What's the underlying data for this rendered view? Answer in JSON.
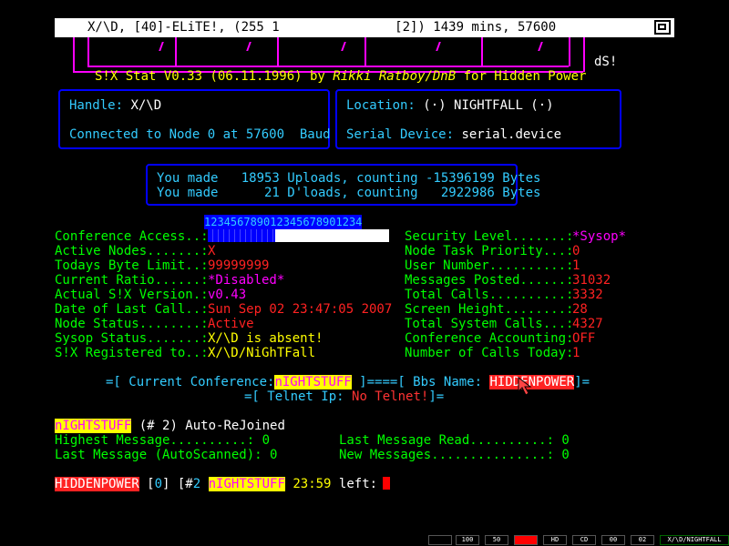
{
  "title_bar": {
    "text": "X/\\D, [40]-ELiTE!, (255 1               [2]) 1439 mins, 57600"
  },
  "header": {
    "stat_line_a": "S!X Stat V0.33 (06.11.1996) by ",
    "author": "Rikki Ratboy/DnB",
    "stat_line_b": " for Hidden Power",
    "ds_label": "dS!"
  },
  "info": {
    "handle_label": "Handle:",
    "handle_value": "X/\\D",
    "location_label": "Location:",
    "location_value": "(·) NIGHTFALL (·)",
    "connected": "Connected to Node 0 at 57600  Baud",
    "serial_label": "Serial Device:",
    "serial_value": "serial.device"
  },
  "transfer": {
    "line1": "You made   18953 Uploads, counting -15396199 Bytes",
    "line2": "You made      21 D'loads, counting   2922986 Bytes"
  },
  "access_ticks": "123456789012345678901234",
  "access_fill_fraction": 0.37,
  "left_stats": [
    {
      "label": "Conference Access..:",
      "value": "",
      "color": "#f22"
    },
    {
      "label": "Active Nodes.......:",
      "value": "X",
      "color": "#f22"
    },
    {
      "label": "Todays Byte Limit..:",
      "value": "99999999",
      "color": "#f22"
    },
    {
      "label": "Current Ratio......:",
      "value": "*Disabled*",
      "color": "#f0f"
    },
    {
      "label": "Actual S!X Version.:",
      "value": "v0.43",
      "color": "#f0f"
    },
    {
      "label": "Date of Last Call..:",
      "value": "Sun Sep 02 23:47:05 2007",
      "color": "#f22"
    },
    {
      "label": "Node Status........:",
      "value": "Active",
      "color": "#f22"
    },
    {
      "label": "Sysop Status.......:",
      "value": "X/\\D is absent!",
      "color": "#ff0"
    },
    {
      "label": "S!X Registered to..:",
      "value": "X/\\D/NiGhTFall",
      "color": "#ff0"
    }
  ],
  "right_stats": [
    {
      "label": "Security Level.......:",
      "value": "*Sysop*",
      "color": "#f0f"
    },
    {
      "label": "Node Task Priority...:",
      "value": "0",
      "color": "#f22"
    },
    {
      "label": "User Number..........:",
      "value": "1",
      "color": "#f22"
    },
    {
      "label": "Messages Posted......:",
      "value": "31032",
      "color": "#f22"
    },
    {
      "label": "Total Calls..........:",
      "value": "3332",
      "color": "#f22"
    },
    {
      "label": "Screen Height........:",
      "value": "28",
      "color": "#f22"
    },
    {
      "label": "Total System Calls...:",
      "value": "4327",
      "color": "#f22"
    },
    {
      "label": "Conference Accounting:",
      "value": "OFF",
      "color": "#f22"
    },
    {
      "label": "Number of Calls Today:",
      "value": "1",
      "color": "#f22"
    }
  ],
  "conference": {
    "prefix": "=[ Current Conference:",
    "name": "nIGHTSTUFF",
    "mid": "]====[ Bbs Name:",
    "bbs": "HIDDENPOWER",
    "suffix": "]=",
    "telnet_label": "=[ Telnet Ip:",
    "telnet_value": "No Telnet!",
    "telnet_suffix": "]="
  },
  "messages": {
    "conf_name": "nIGHTSTUFF",
    "conf_info": " (# 2) Auto-ReJoined",
    "highest": "Highest Message..........: 0",
    "last_scanned": "Last Message (AutoScanned): 0",
    "last_read": "Last Message Read..........: 0",
    "new_msgs": "New Messages...............: 0"
  },
  "prompt": {
    "bbs": "HIDDENPOWER",
    "p1": " [",
    "num": "0",
    "p2": "] [#",
    "confnum": "2",
    "conf": "nIGHTSTUFF",
    "time": " 23:59",
    "left": " left:"
  },
  "statusbar": {
    "items": [
      "100",
      "50",
      "",
      "HD",
      "CD",
      "00",
      "02",
      "X/\\D/NIGHTFALL"
    ]
  }
}
